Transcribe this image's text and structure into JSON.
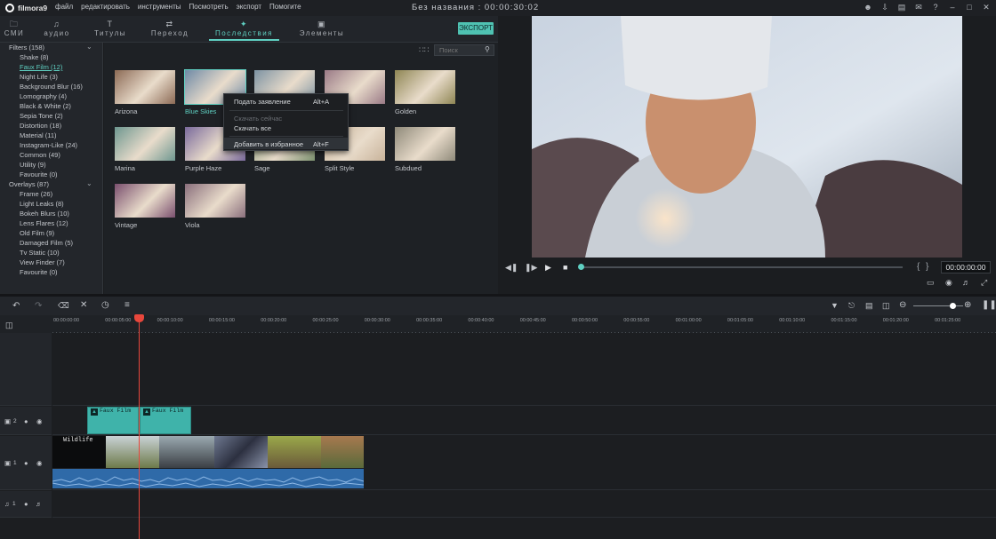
{
  "app": {
    "name": "filmora9",
    "title": "Без названия : 00:00:30:02"
  },
  "menu": [
    "файл",
    "редактировать",
    "инструменты",
    "Посмотреть",
    "экспорт",
    "Помогите"
  ],
  "window_icons": [
    "user-icon",
    "save-icon",
    "cart-icon",
    "mail-icon",
    "help-icon",
    "minimize-icon",
    "maximize-icon",
    "close-icon"
  ],
  "tabs": [
    {
      "label": "СМИ",
      "icon": "folder-icon"
    },
    {
      "label": "аудио",
      "icon": "note-icon"
    },
    {
      "label": "Титулы",
      "icon": "text-icon"
    },
    {
      "label": "Переход",
      "icon": "transition-icon"
    },
    {
      "label": "Последствия",
      "icon": "effects-icon"
    },
    {
      "label": "Элементы",
      "icon": "elements-icon"
    }
  ],
  "export_label": "ЭКСПОРТ",
  "search": {
    "placeholder": "Поиск"
  },
  "sidebar": {
    "filters_header": "Filters (158)",
    "filters": [
      "Shake (8)",
      "Faux Film (12)",
      "Night Life (3)",
      "Background Blur (16)",
      "Lomography (4)",
      "Black & White (2)",
      "Sepia Tone (2)",
      "Distortion (18)",
      "Material (11)",
      "Instagram-Like (24)",
      "Common (49)",
      "Utility (9)",
      "Favourite (0)"
    ],
    "overlays_header": "Overlays (87)",
    "overlays": [
      "Frame (26)",
      "Light Leaks (8)",
      "Bokeh Blurs (10)",
      "Lens Flares (12)",
      "Old Film (9)",
      "Damaged Film (5)",
      "Tv Static (10)",
      "View Finder (7)",
      "Favourite (0)"
    ]
  },
  "effects": [
    {
      "label": "Arizona",
      "color": "#8c6a55"
    },
    {
      "label": "Blue Skies",
      "color": "#6f8aa6"
    },
    {
      "label": "",
      "color": "#7d93a3"
    },
    {
      "label": "",
      "color": "#9a7a86"
    },
    {
      "label": "Golden",
      "color": "#8f8654"
    },
    {
      "label": "Marina",
      "color": "#6e9790"
    },
    {
      "label": "Purple Haze",
      "color": "#7a6a9c"
    },
    {
      "label": "Sage",
      "color": "#7d9270"
    },
    {
      "label": "Split Style",
      "color": "#c8b39a"
    },
    {
      "label": "Subdued",
      "color": "#8f8a7a"
    },
    {
      "label": "Vintage",
      "color": "#7a4f6e"
    },
    {
      "label": "Viola",
      "color": "#8a6f7c"
    }
  ],
  "context_menu": [
    {
      "label": "Подать заявление",
      "shortcut": "Alt+A",
      "disabled": false
    },
    {
      "label": "Скачать сейчас",
      "shortcut": "",
      "disabled": true
    },
    {
      "label": "Скачать все",
      "shortcut": "",
      "disabled": false
    },
    {
      "label": "Добавить в избранное",
      "shortcut": "Alt+F",
      "disabled": false
    }
  ],
  "player": {
    "time": "00:00:00:00",
    "progress": 0.0
  },
  "zoom_level": 0.79,
  "ruler": [
    "00:00:00:00",
    "00:00:05:00",
    "00:00:10:00",
    "00:00:15:00",
    "00:00:20:00",
    "00:00:25:00",
    "00:00:30:00",
    "00:00:35:00",
    "00:00:40:00",
    "00:00:45:00",
    "00:00:50:00",
    "00:00:55:00",
    "00:01:00:00",
    "00:01:05:00",
    "00:01:10:00",
    "00:01:15:00",
    "00:01:20:00",
    "00:01:25:00"
  ],
  "tracks": {
    "video2_label": "2",
    "video1_label": "1",
    "audio1_label": "1",
    "clip_fx": [
      "Faux Film",
      "Faux Film"
    ],
    "clip_title": "Wildlife"
  },
  "colors": {
    "accent": "#5fd0c2",
    "playhead": "#e8473c",
    "fx_clip": "#3fb3aa",
    "audio_clip": "#2f6aa8"
  }
}
